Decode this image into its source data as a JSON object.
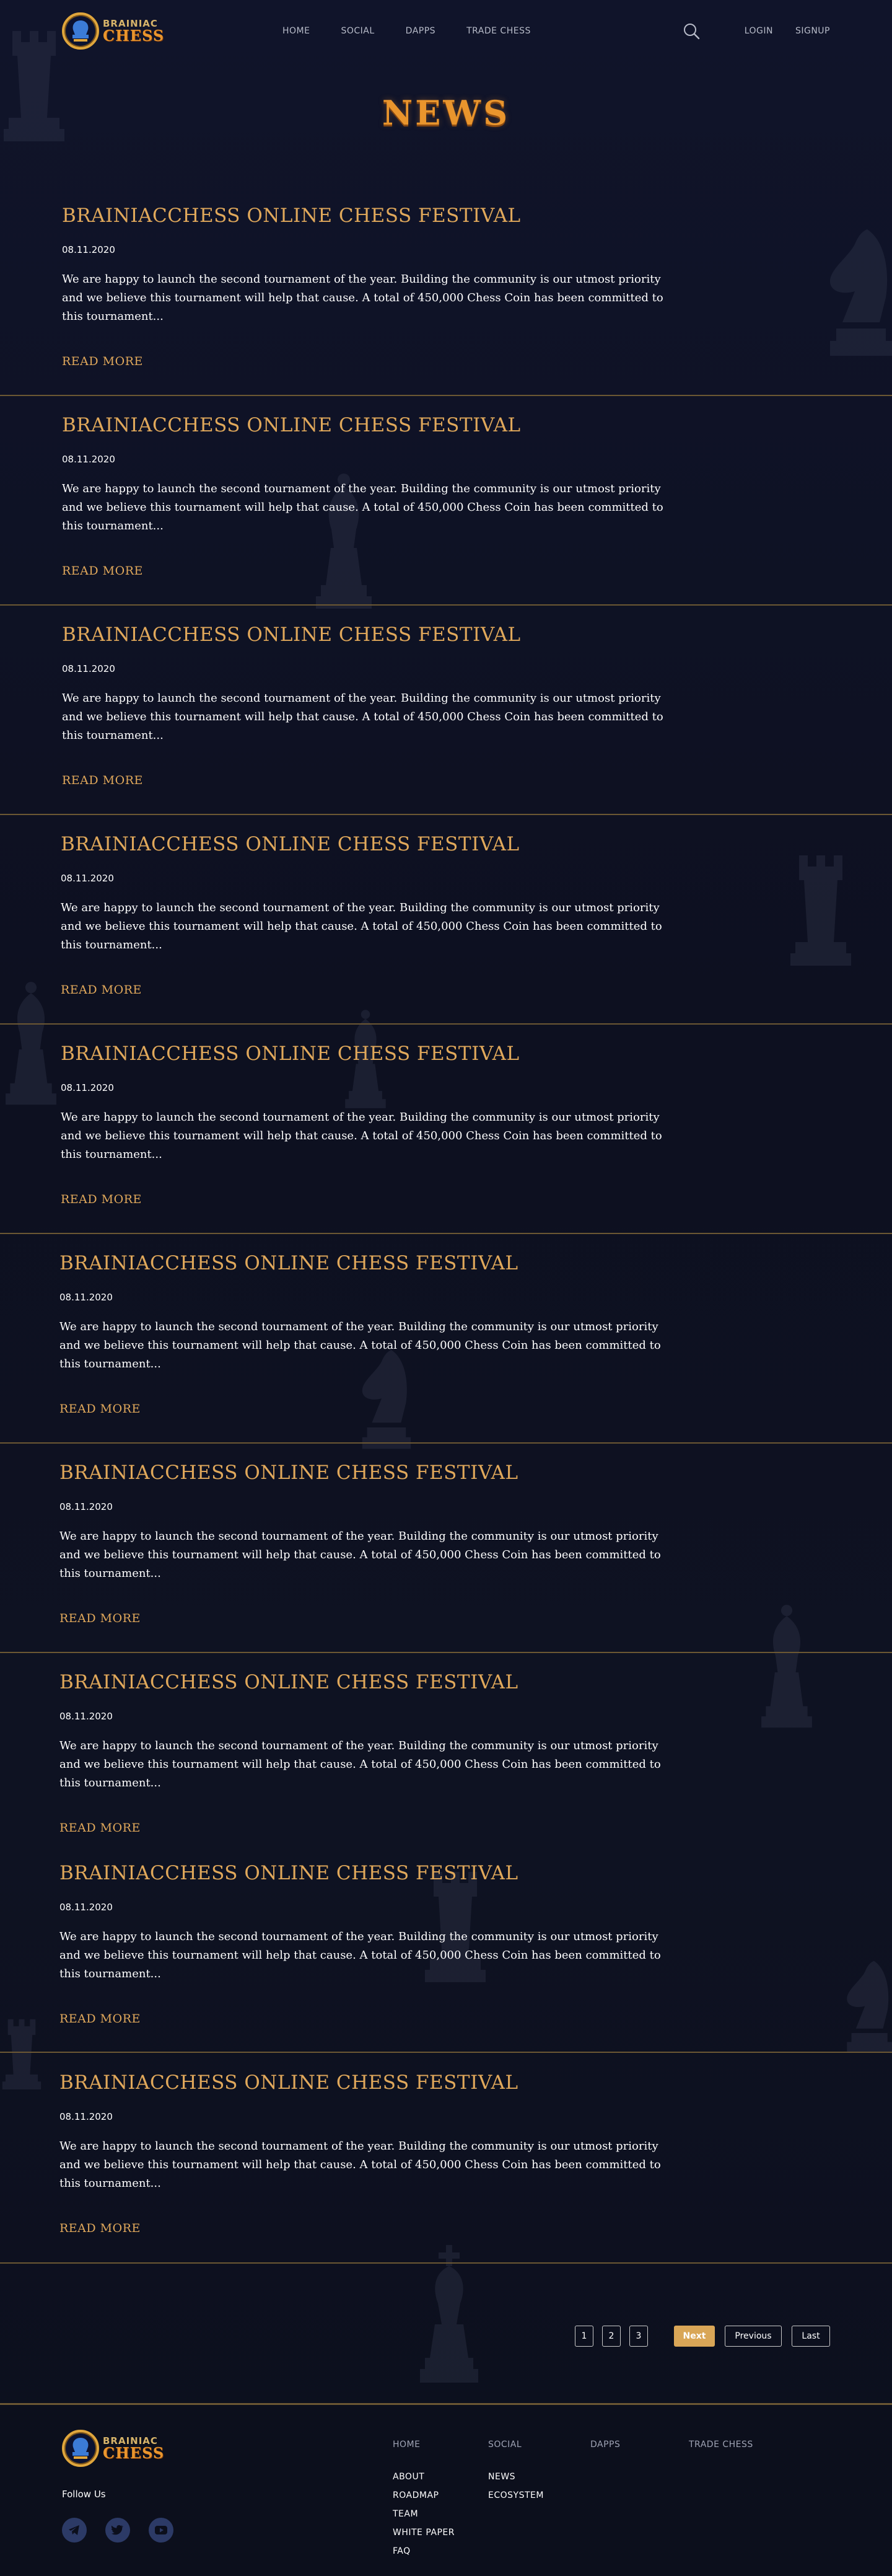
{
  "brand": {
    "line1": "BRAINIAC",
    "line2": "CHESS"
  },
  "nav": [
    "HOME",
    "SOCIAL",
    "DAPPS",
    "TRADE CHESS"
  ],
  "header_links": {
    "login": "LOGIN",
    "signup": "SIGNUP"
  },
  "page_title": "NEWS",
  "articles": [
    {
      "title": "BRAINIACCHESS ONLINE CHESS FESTIVAL",
      "date": "08.11.2020",
      "body": "We are happy to launch the second tournament of the year. Building the community is our utmost priority and we believe this tournament will help that cause. A total of 450,000 Chess Coin has been committed to this tournament...",
      "more": "READ MORE"
    },
    {
      "title": "BRAINIACCHESS ONLINE CHESS FESTIVAL",
      "date": "08.11.2020",
      "body": "We are happy to launch the second tournament of the year. Building the community is our utmost priority and we believe this tournament will help that cause. A total of 450,000 Chess Coin has been committed to this tournament...",
      "more": "READ MORE"
    },
    {
      "title": "BRAINIACCHESS ONLINE CHESS FESTIVAL",
      "date": "08.11.2020",
      "body": "We are happy to launch the second tournament of the year. Building the community is our utmost priority and we believe this tournament will help that cause. A total of 450,000 Chess Coin has been committed to this tournament...",
      "more": "READ MORE"
    },
    {
      "title": "BRAINIACCHESS ONLINE CHESS FESTIVAL",
      "date": "08.11.2020",
      "body": "We are happy to launch the second tournament of the year. Building the community is our utmost priority and we believe this tournament will help that cause. A total of 450,000 Chess Coin has been committed to this tournament...",
      "more": "READ MORE"
    },
    {
      "title": "BRAINIACCHESS ONLINE CHESS FESTIVAL",
      "date": "08.11.2020",
      "body": "We are happy to launch the second tournament of the year. Building the community is our utmost priority and we believe this tournament will help that cause. A total of 450,000 Chess Coin has been committed to this tournament...",
      "more": "READ MORE"
    },
    {
      "title": "BRAINIACCHESS ONLINE CHESS FESTIVAL",
      "date": "08.11.2020",
      "body": "We are happy to launch the second tournament of the year. Building the community is our utmost priority and we believe this tournament will help that cause. A total of 450,000 Chess Coin has been committed to this tournament...",
      "more": "READ MORE"
    },
    {
      "title": "BRAINIACCHESS ONLINE CHESS FESTIVAL",
      "date": "08.11.2020",
      "body": "We are happy to launch the second tournament of the year. Building the community is our utmost priority and we believe this tournament will help that cause. A total of 450,000 Chess Coin has been committed to this tournament...",
      "more": "READ MORE"
    },
    {
      "title": "BRAINIACCHESS ONLINE CHESS FESTIVAL",
      "date": "08.11.2020",
      "body": "We are happy to launch the second tournament of the year. Building the community is our utmost priority and we believe this tournament will help that cause. A total of 450,000 Chess Coin has been committed to this tournament...",
      "more": "READ MORE"
    },
    {
      "title": "BRAINIACCHESS ONLINE CHESS FESTIVAL",
      "date": "08.11.2020",
      "body": "We are happy to launch the second tournament of the year. Building the community is our utmost priority and we believe this tournament will help that cause. A total of 450,000 Chess Coin has been committed to this tournament...",
      "more": "READ MORE"
    },
    {
      "title": "BRAINIACCHESS ONLINE CHESS FESTIVAL",
      "date": "08.11.2020",
      "body": "We are happy to launch the second tournament of the year. Building the community is our utmost priority and we believe this tournament will help that cause. A total of 450,000 Chess Coin has been committed to this tournament...",
      "more": "READ MORE"
    }
  ],
  "pagination": {
    "pages": [
      "1",
      "2",
      "3"
    ],
    "next": "Next",
    "previous": "Previous",
    "last": "Last"
  },
  "footer": {
    "follow": "Follow Us",
    "columns": [
      {
        "heading": "HOME",
        "items": [
          "ABOUT",
          "ROADMAP",
          "TEAM",
          "WHITE PAPER",
          "FAQ"
        ]
      },
      {
        "heading": "SOCIAL",
        "items": [
          "NEWS",
          "ECOSYSTEM"
        ]
      },
      {
        "heading": "DAPPS",
        "items": []
      },
      {
        "heading": "TRADE CHESS",
        "items": []
      }
    ],
    "social_icons": [
      "telegram-icon",
      "twitter-icon",
      "youtube-icon"
    ]
  },
  "colors": {
    "accent": "#e0a85b",
    "background": "#0f1222",
    "divider": "#6b5733",
    "button": "#d9a657"
  }
}
